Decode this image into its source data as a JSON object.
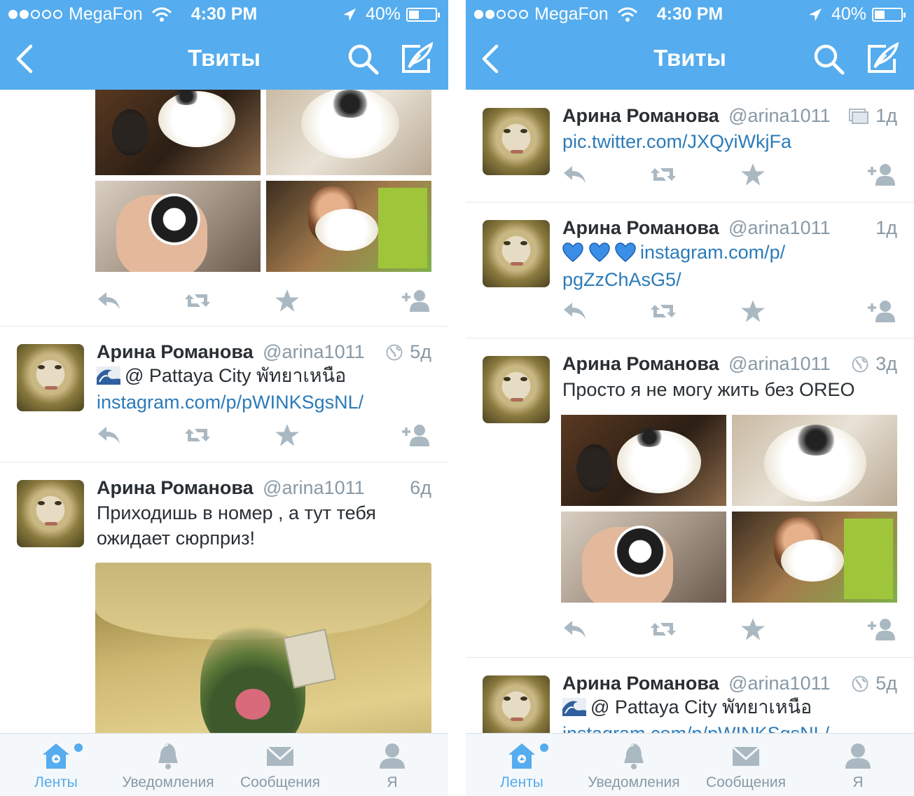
{
  "status_bar": {
    "carrier": "MegaFon",
    "time": "4:30 PM",
    "battery": "40%",
    "battery_level": 0.4,
    "signal_bars_filled": 2,
    "signal_bars_total": 5
  },
  "navbar": {
    "title": "Твиты"
  },
  "tabbar": {
    "items": [
      {
        "label": "Ленты",
        "icon": "home-icon"
      },
      {
        "label": "Уведомления",
        "icon": "bell-icon"
      },
      {
        "label": "Сообщения",
        "icon": "envelope-icon"
      },
      {
        "label": "Я",
        "icon": "person-icon"
      }
    ]
  },
  "left_screen": {
    "tweets": [
      {
        "name": "Арина Романова",
        "handle": "@arina1011",
        "time": "5д",
        "text": "@ Pattaya City พัทยาเหนือ",
        "link": "instagram.com/p/pWINKSgsNL/"
      },
      {
        "name": "Арина Романова",
        "handle": "@arina1011",
        "time": "6д",
        "text_line1": "Приходишь в номер , а тут тебя",
        "text_line2": "ожидает сюрприз!"
      }
    ]
  },
  "right_screen": {
    "tweets": [
      {
        "name": "Арина Романова",
        "handle": "@arina1011",
        "time": "1д",
        "link": "pic.twitter.com/JXQyiWkjFa"
      },
      {
        "name": "Арина Романова",
        "handle": "@arina1011",
        "time": "1д",
        "emoji": "💙💙💙",
        "link_line1": "instagram.com/p/",
        "link_line2": "pgZzChAsG5/"
      },
      {
        "name": "Арина Романова",
        "handle": "@arina1011",
        "time": "3д",
        "text": "Просто я не могу жить без OREO"
      },
      {
        "name": "Арина Романова",
        "handle": "@arina1011",
        "time": "5д",
        "text": "@ Pattaya City พัทยาเหนือ",
        "link": "instagram.com/p/pWINKSgsNL/"
      }
    ]
  },
  "colors": {
    "brand_blue": "#55acee",
    "link_blue": "#2b7bb9",
    "muted_gray": "#8899a6",
    "action_gray": "#aab8c2",
    "text_dark": "#292f33"
  }
}
